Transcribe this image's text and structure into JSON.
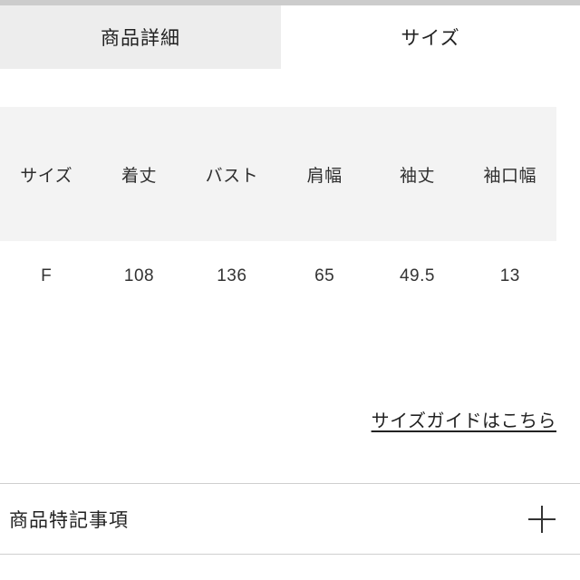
{
  "colors": {
    "top_strip": "#cccccc",
    "inactive_tab_bg": "#ededed",
    "table_header_bg": "#f3f3f3",
    "divider": "#cfcfcf",
    "text": "#333333"
  },
  "tabs": [
    {
      "label": "商品詳細",
      "active": false
    },
    {
      "label": "サイズ",
      "active": true
    }
  ],
  "size_table": {
    "headers": [
      "サイズ",
      "着丈",
      "バスト",
      "肩幅",
      "袖丈",
      "袖口幅"
    ],
    "rows": [
      [
        "F",
        "108",
        "136",
        "65",
        "49.5",
        "13"
      ]
    ]
  },
  "size_guide": {
    "label": "サイズガイドはこちら"
  },
  "accordion": {
    "label": "商品特記事項",
    "toggle_icon": "plus-icon"
  }
}
